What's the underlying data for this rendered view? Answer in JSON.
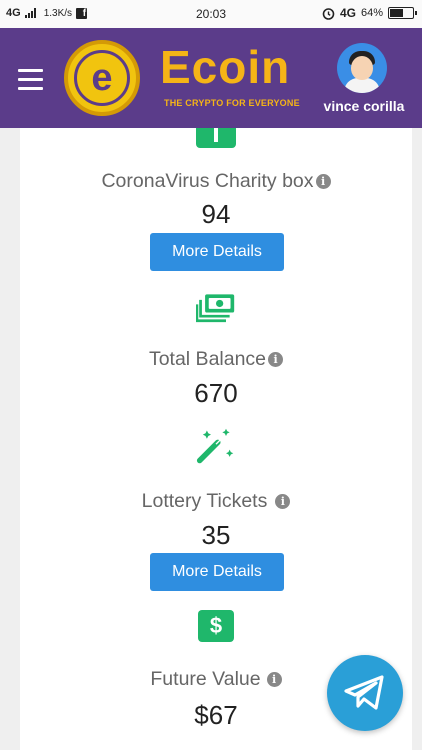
{
  "status_bar": {
    "network": "4G",
    "speed": "1.3K/s",
    "time": "20:03",
    "network_right": "4G",
    "battery": "64%",
    "battery_level": 0.64,
    "facebook_icon": "facebook-icon"
  },
  "header": {
    "brand_name": "Ecoin",
    "tagline": "THE CRYPTO FOR EVERYONE",
    "coin_letter": "e",
    "username": "vince corilla",
    "colors": {
      "background": "#5b3c8a",
      "brand": "#f5b417"
    }
  },
  "stats": [
    {
      "label": "CoronaVirus Charity box",
      "value": "94",
      "button": "More Details",
      "icon": "charity-icon"
    },
    {
      "label": "Total Balance",
      "value": "670",
      "icon": "money-stack-icon"
    },
    {
      "label": "Lottery Tickets",
      "value": "35",
      "button": "More Details",
      "icon": "magic-wand-icon"
    },
    {
      "label": "Future Value",
      "value": "$67",
      "icon": "dollar-icon"
    }
  ],
  "icon_glyphs": {
    "info": "i",
    "dollar": "$"
  },
  "floating_button": {
    "icon": "telegram-icon"
  },
  "colors": {
    "accent_green": "#1fb76b",
    "button_blue": "#2f8ee0",
    "telegram_blue": "#2a9fd7"
  }
}
